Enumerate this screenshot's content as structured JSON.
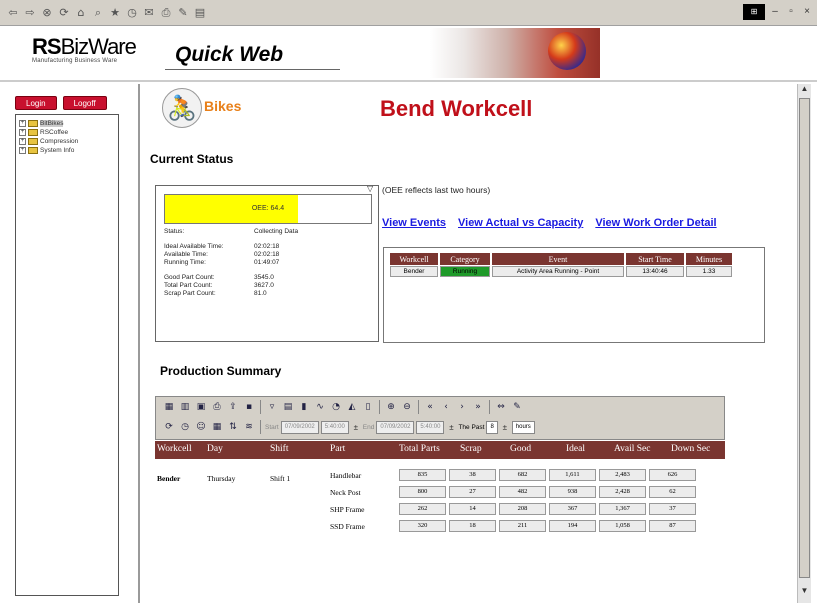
{
  "browser": {
    "toolbar_icons": [
      "back-icon",
      "forward-icon",
      "stop-icon",
      "refresh-icon",
      "home-icon",
      "search-icon",
      "favorites-icon",
      "history-icon",
      "mail-icon",
      "print-icon",
      "edit-icon",
      "discuss-icon"
    ]
  },
  "banner": {
    "brand_name_bold": "RS",
    "brand_name_rest": "BizWare",
    "brand_tagline": "Manufacturing Business Ware",
    "product_name": "Quick Web"
  },
  "left_pane": {
    "login_label": "Login",
    "logoff_label": "Logoff",
    "tree": [
      {
        "label": "BitBikes",
        "selected": true
      },
      {
        "label": "RSCoffee",
        "selected": false
      },
      {
        "label": "Compression",
        "selected": false
      },
      {
        "label": "System Info",
        "selected": false
      }
    ]
  },
  "main": {
    "company_logo_text": "Bikes",
    "page_title": "Bend Workcell",
    "current_status_heading": "Current Status",
    "oee_label": "OEE: 64.4",
    "oee_percent": 64.4,
    "status": [
      {
        "k": "Status:",
        "v": "Collecting Data"
      },
      {
        "k": "Ideal Available Time:",
        "v": "02:02:18"
      },
      {
        "k": "Available Time:",
        "v": "02:02:18"
      },
      {
        "k": "Running Time:",
        "v": "01:49:07"
      },
      {
        "k": "Good Part Count:",
        "v": "3545.0"
      },
      {
        "k": "Total Part Count:",
        "v": "3627.0"
      },
      {
        "k": "Scrap Part Count:",
        "v": "81.0"
      }
    ],
    "oee_note": "(OEE reflects last two hours)",
    "links": {
      "view_events": "View Events",
      "view_actual_vs_capacity": "View Actual vs Capacity",
      "view_work_order_detail": "View Work Order Detail"
    },
    "events_table": {
      "headers": [
        "Workcell",
        "Category",
        "Event",
        "Start Time",
        "Minutes"
      ],
      "rows": [
        {
          "workcell": "Bender",
          "category": "Running",
          "event": "Activity Area Running - Point",
          "start_time": "13:40:46",
          "minutes": "1.33"
        }
      ],
      "category_color": "#1f9a2a"
    },
    "production_heading": "Production Summary",
    "toolbar": {
      "row1_icons": [
        "grid-icon",
        "chart-icon",
        "pivot-icon",
        "print-icon",
        "export-icon",
        "save-icon",
        "filter-icon",
        "table-icon",
        "chart-bar-icon",
        "chart-line-icon",
        "chart-pie-icon",
        "chart-area-icon",
        "chart-column-icon",
        "zoom-in-icon",
        "zoom-out-icon",
        "first-icon",
        "prev-icon",
        "next-icon",
        "last-icon",
        "fit-icon",
        "paint-icon"
      ],
      "row2_icons": [
        "refresh-icon",
        "clock-icon",
        "people-icon",
        "calendar-icon",
        "sort-icon",
        "options-icon"
      ],
      "start_label": "Start",
      "start_date": "07/09/2002",
      "start_time": "5:40:00",
      "end_label": "End",
      "end_date": "07/09/2002",
      "end_time": "5:40:00",
      "the_past_label": "The Past",
      "the_past_value": "8",
      "unit_value": "hours"
    },
    "production_table": {
      "headers": [
        "Workcell",
        "Day",
        "Shift",
        "Part",
        "Total Parts",
        "Scrap",
        "Good",
        "Ideal",
        "Avail Sec",
        "Down Sec"
      ],
      "group": {
        "workcell": "Bender",
        "day": "Thursday",
        "shift": "Shift 1"
      },
      "rows": [
        {
          "part": "Handlebar",
          "total": "835",
          "scrap": "38",
          "good": "682",
          "ideal": "1,611",
          "avail": "2,483",
          "down": "626"
        },
        {
          "part": "Neck Post",
          "total": "800",
          "scrap": "27",
          "good": "482",
          "ideal": "938",
          "avail": "2,428",
          "down": "62"
        },
        {
          "part": "SHP Frame",
          "total": "262",
          "scrap": "14",
          "good": "208",
          "ideal": "367",
          "avail": "1,367",
          "down": "37"
        },
        {
          "part": "SSD Frame",
          "total": "320",
          "scrap": "18",
          "good": "211",
          "ideal": "194",
          "avail": "1,058",
          "down": "87"
        }
      ]
    },
    "colors": {
      "title_red": "#c0101a",
      "header_maroon": "#7a3530",
      "oee_yellow": "#ffff00",
      "link_blue": "#1a1ae0",
      "button_red": "#c8102e"
    }
  }
}
